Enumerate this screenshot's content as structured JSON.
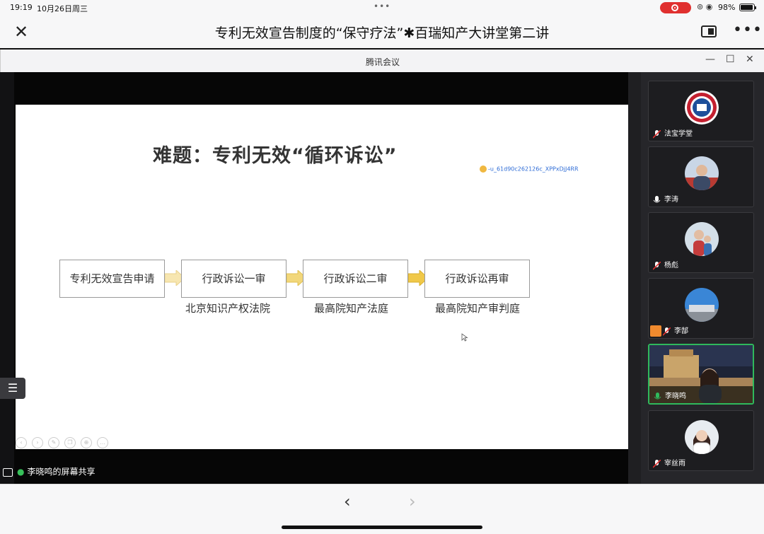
{
  "status_bar": {
    "time": "19:19",
    "date": "10月26日周三",
    "battery_percent": "98%"
  },
  "nav": {
    "title": "专利无效宣告制度的“保守疗法”✱百瑞知产大讲堂第二讲"
  },
  "meeting_window": {
    "title": "腾讯会议",
    "controls": {
      "minimize": "—",
      "maximize": "☐",
      "close": "✕"
    }
  },
  "slide": {
    "heading": "难题：专利无效“循环诉讼”",
    "watermark": "-u_61d90c262126c_XPPxDjJ4RR",
    "flow": [
      {
        "label": "专利无效宣告申请",
        "sublabel": ""
      },
      {
        "label": "行政诉讼一审",
        "sublabel": "北京知识产权法院"
      },
      {
        "label": "行政诉讼二审",
        "sublabel": "最高院知产法庭"
      },
      {
        "label": "行政诉讼再审",
        "sublabel": "最高院知产审判庭"
      }
    ]
  },
  "share_label": "李晓鸣的屏幕共享",
  "participants": [
    {
      "name": "法宝学堂",
      "mic": "muted",
      "active": false,
      "avatar": "logo-seal"
    },
    {
      "name": "李涛",
      "mic": "on",
      "active": false,
      "avatar": "photo"
    },
    {
      "name": "杨彪",
      "mic": "muted",
      "active": false,
      "avatar": "photo"
    },
    {
      "name": "李郜",
      "mic": "muted",
      "active": false,
      "avatar": "building"
    },
    {
      "name": "李晓鸣",
      "mic": "on",
      "active": true,
      "avatar": "video"
    },
    {
      "name": "宰丝雨",
      "mic": "muted",
      "active": false,
      "avatar": "photo"
    }
  ],
  "colors": {
    "accent_green": "#2fb95c",
    "record_red": "#e0302f",
    "arrow_gold": "#f0c848"
  }
}
